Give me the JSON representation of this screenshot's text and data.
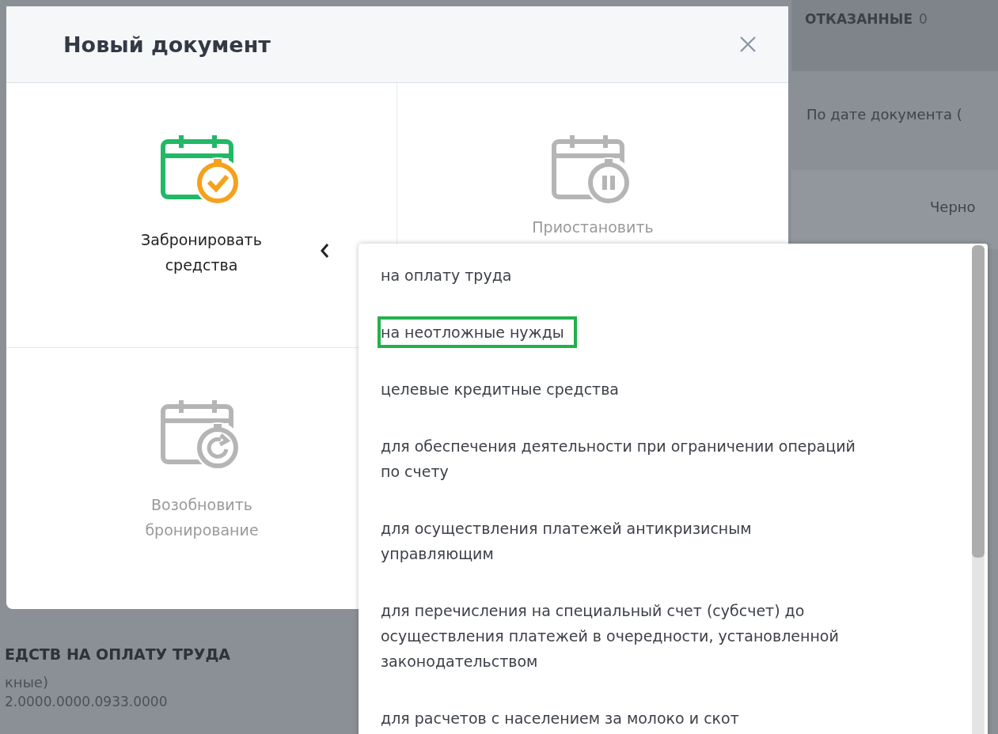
{
  "background": {
    "right_header": {
      "label": "ОТКАЗАННЫЕ",
      "count": "0"
    },
    "sort_label": "По дате документа (",
    "row_text": "Черно",
    "section_title": "ЕДСТВ НА ОПЛАТУ ТРУДА",
    "section_subtitle": "кные)",
    "account_number": "2.0000.0000.0933.0000"
  },
  "dialog": {
    "title": "Новый документ",
    "tiles": [
      {
        "label": "Забронировать средства",
        "kind": "check",
        "disabled": false,
        "expanded": true
      },
      {
        "label": "Приостановить",
        "kind": "pause",
        "disabled": true,
        "expanded": false
      },
      {
        "label": "Возобновить бронирование",
        "kind": "refresh",
        "disabled": true,
        "expanded": false
      }
    ]
  },
  "dropdown": {
    "items": [
      {
        "label": "на оплату труда",
        "selected": false
      },
      {
        "label": "на неотложные нужды",
        "selected": true
      },
      {
        "label": "целевые кредитные средства",
        "selected": false
      },
      {
        "label": "для обеспечения деятельности при ограничении операций по счету",
        "selected": false
      },
      {
        "label": "для осуществления платежей антикризисным управляющим",
        "selected": false
      },
      {
        "label": "для перечисления на специальный счет (субсчет) до осуществления платежей в очередности, установленной законодательством",
        "selected": false
      },
      {
        "label": "для расчетов с населением за молоко и скот",
        "selected": false
      }
    ]
  }
}
